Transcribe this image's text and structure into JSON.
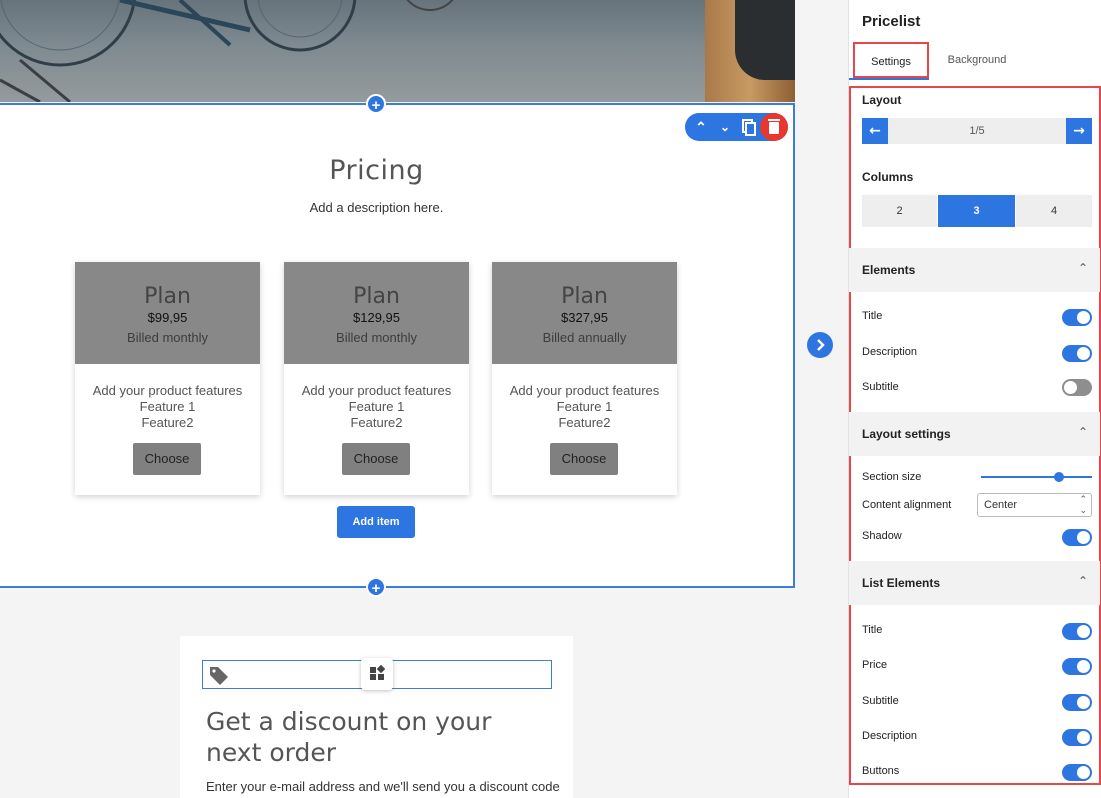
{
  "pricing": {
    "title": "Pricing",
    "description": "Add a description here.",
    "add_item_label": "Add item",
    "plans": [
      {
        "name": "Plan",
        "price": "$99,95",
        "billing": "Billed monthly",
        "features": [
          "Add your product features",
          "Feature 1",
          "Feature2"
        ],
        "button": "Choose"
      },
      {
        "name": "Plan",
        "price": "$129,95",
        "billing": "Billed monthly",
        "features": [
          "Add your product features",
          "Feature 1",
          "Feature2"
        ],
        "button": "Choose"
      },
      {
        "name": "Plan",
        "price": "$327,95",
        "billing": "Billed annually",
        "features": [
          "Add your product features",
          "Feature 1",
          "Feature2"
        ],
        "button": "Choose"
      }
    ]
  },
  "discount": {
    "title": "Get a discount on your next order",
    "text": "Enter your e-mail address and we'll send you a discount code"
  },
  "panel": {
    "title": "Pricelist",
    "tabs": [
      "Settings",
      "Background"
    ],
    "layout": {
      "label": "Layout",
      "page": "1/5"
    },
    "columns": {
      "label": "Columns",
      "options": [
        "2",
        "3",
        "4"
      ],
      "selected": "3"
    },
    "elements": {
      "label": "Elements",
      "items": [
        {
          "label": "Title",
          "on": true
        },
        {
          "label": "Description",
          "on": true
        },
        {
          "label": "Subtitle",
          "on": false
        }
      ]
    },
    "layout_settings": {
      "label": "Layout settings",
      "section_size_label": "Section size",
      "section_size_value": 0.7,
      "content_alignment_label": "Content alignment",
      "content_alignment_value": "Center",
      "shadow_label": "Shadow",
      "shadow_on": true
    },
    "list_elements": {
      "label": "List Elements",
      "items": [
        {
          "label": "Title",
          "on": true
        },
        {
          "label": "Price",
          "on": true
        },
        {
          "label": "Subtitle",
          "on": true
        },
        {
          "label": "Description",
          "on": true
        },
        {
          "label": "Buttons",
          "on": true
        }
      ]
    }
  },
  "colors": {
    "accent": "#2d75e1",
    "highlight": "#e8474a",
    "delete": "#e8372f"
  },
  "icons": {
    "add": "plus-icon",
    "up": "chevron-up-icon",
    "down": "chevron-down-icon",
    "copy": "copy-icon",
    "delete": "trash-icon",
    "tag": "tag-icon",
    "move": "widget-move-icon",
    "expand": "chevron-right-icon"
  }
}
